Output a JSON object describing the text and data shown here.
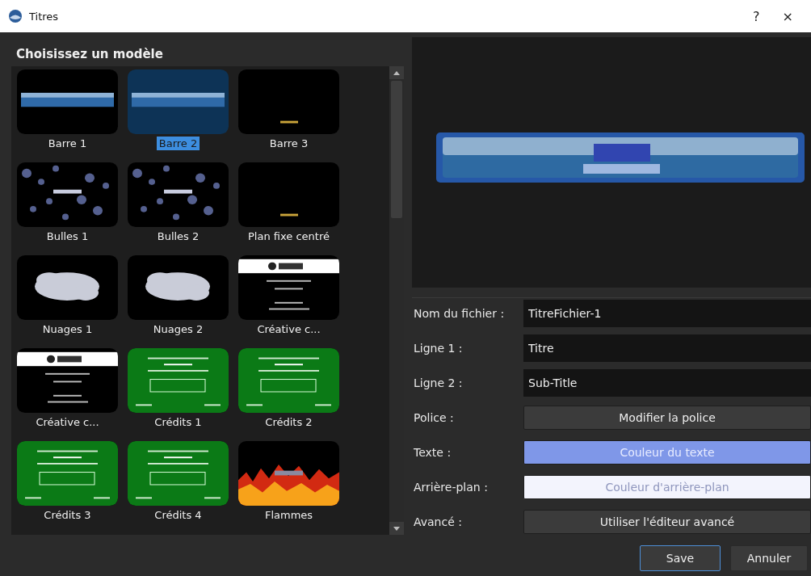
{
  "window": {
    "title": "Titres",
    "help": "?",
    "close": "×"
  },
  "templates": {
    "heading": "Choisissez un modèle",
    "items": [
      {
        "label": "Barre 1",
        "kind": "bar",
        "selected": false
      },
      {
        "label": "Barre 2",
        "kind": "bar",
        "selected": true
      },
      {
        "label": "Barre 3",
        "kind": "plain",
        "selected": false
      },
      {
        "label": "Bulles 1",
        "kind": "bubbles",
        "selected": false
      },
      {
        "label": "Bulles 2",
        "kind": "bubbles",
        "selected": false
      },
      {
        "label": "Plan fixe centré",
        "kind": "plain",
        "selected": false
      },
      {
        "label": "Nuages 1",
        "kind": "clouds",
        "selected": false
      },
      {
        "label": "Nuages 2",
        "kind": "clouds",
        "selected": false
      },
      {
        "label": "Créative c...",
        "kind": "cc",
        "selected": false
      },
      {
        "label": "Créative c...",
        "kind": "cc",
        "selected": false
      },
      {
        "label": "Crédits 1",
        "kind": "credits",
        "selected": false
      },
      {
        "label": "Crédits 2",
        "kind": "credits",
        "selected": false
      },
      {
        "label": "Crédits 3",
        "kind": "credits",
        "selected": false
      },
      {
        "label": "Crédits 4",
        "kind": "credits",
        "selected": false
      },
      {
        "label": "Flammes",
        "kind": "flames",
        "selected": false
      }
    ]
  },
  "form": [
    {
      "label": "Nom du fichier :",
      "kind": "field",
      "value": "TitreFichier-1"
    },
    {
      "label": "Ligne 1 :",
      "kind": "field",
      "value": "Titre"
    },
    {
      "label": "Ligne 2 :",
      "kind": "field",
      "value": "Sub-Title"
    },
    {
      "label": "Police :",
      "kind": "button",
      "text": "Modifier la police"
    },
    {
      "label": "Texte :",
      "kind": "color",
      "text": "Couleur du texte",
      "color": "#7f97e8"
    },
    {
      "label": "Arrière-plan :",
      "kind": "color",
      "text": "Couleur d'arrière-plan",
      "color": "#f3f4fd"
    },
    {
      "label": "Avancé :",
      "kind": "button",
      "text": "Utiliser l'éditeur avancé"
    }
  ],
  "buttons": [
    {
      "label": "Save",
      "kind": "default"
    },
    {
      "label": "Annuler",
      "kind": "normal"
    }
  ]
}
